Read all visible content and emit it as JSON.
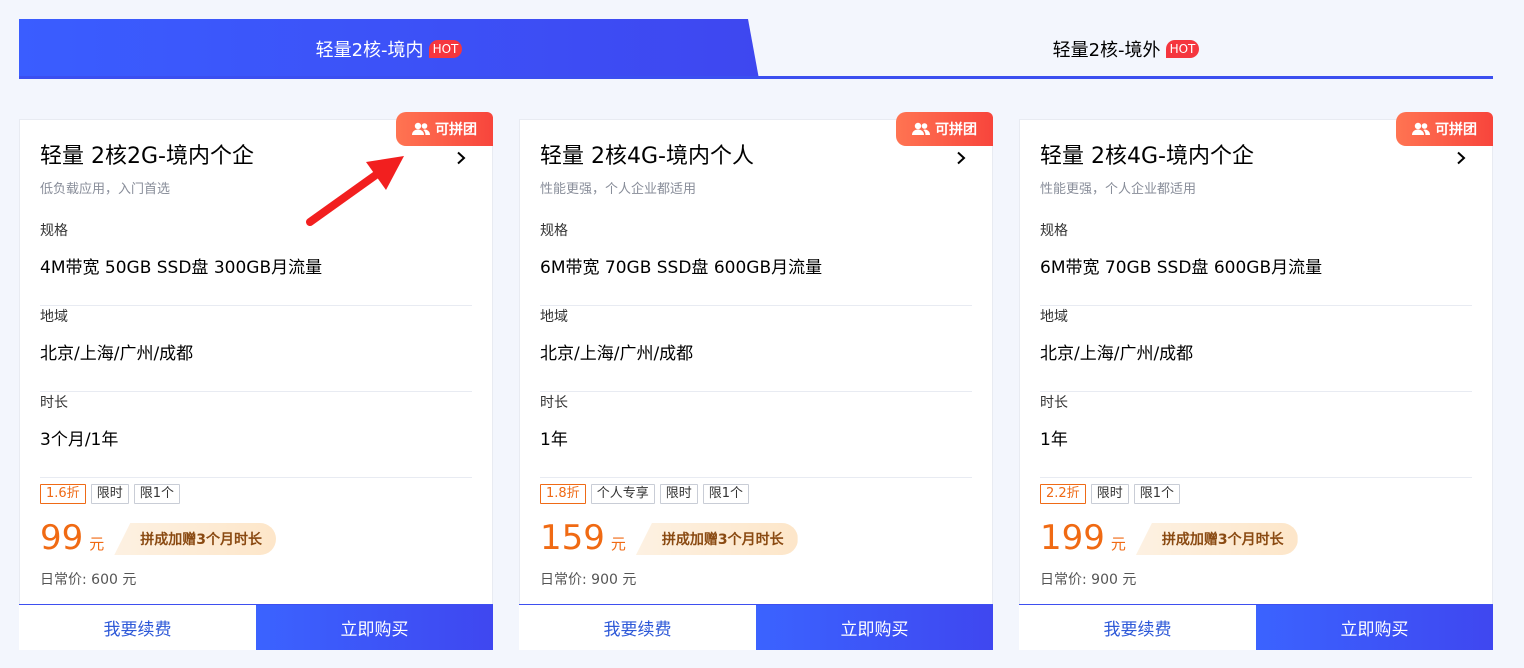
{
  "tabs": [
    {
      "label": "轻量2核-境内",
      "badge": "HOT"
    },
    {
      "label": "轻量2核-境外",
      "badge": "HOT"
    }
  ],
  "cards": [
    {
      "badge": "可拼团",
      "title": "轻量 2核2G-境内个企",
      "subtitle": "低负载应用，入门首选",
      "fields": [
        {
          "label": "规格",
          "value": "4M带宽 50GB SSD盘 300GB月流量"
        },
        {
          "label": "地域",
          "value": "北京/上海/广州/成都"
        },
        {
          "label": "时长",
          "value": "3个月/1年"
        }
      ],
      "tags": [
        "1.6折",
        "限时",
        "限1个"
      ],
      "price": "99",
      "unit": "元",
      "promo": "拼成加赠3个月时长",
      "original_price": "日常价: 600 元",
      "renew_label": "我要续费",
      "buy_label": "立即购买"
    },
    {
      "badge": "可拼团",
      "title": "轻量 2核4G-境内个人",
      "subtitle": "性能更强，个人企业都适用",
      "fields": [
        {
          "label": "规格",
          "value": "6M带宽 70GB SSD盘 600GB月流量"
        },
        {
          "label": "地域",
          "value": "北京/上海/广州/成都"
        },
        {
          "label": "时长",
          "value": "1年"
        }
      ],
      "tags": [
        "1.8折",
        "个人专享",
        "限时",
        "限1个"
      ],
      "price": "159",
      "unit": "元",
      "promo": "拼成加赠3个月时长",
      "original_price": "日常价: 900 元",
      "renew_label": "我要续费",
      "buy_label": "立即购买"
    },
    {
      "badge": "可拼团",
      "title": "轻量 2核4G-境内个企",
      "subtitle": "性能更强，个人企业都适用",
      "fields": [
        {
          "label": "规格",
          "value": "6M带宽 70GB SSD盘 600GB月流量"
        },
        {
          "label": "地域",
          "value": "北京/上海/广州/成都"
        },
        {
          "label": "时长",
          "value": "1年"
        }
      ],
      "tags": [
        "2.2折",
        "限时",
        "限1个"
      ],
      "price": "199",
      "unit": "元",
      "promo": "拼成加赠3个月时长",
      "original_price": "日常价: 900 元",
      "renew_label": "我要续费",
      "buy_label": "立即购买"
    }
  ],
  "colors": {
    "accent_blue": "#3e47f0",
    "price_orange": "#f06a13",
    "badge_red": "#f8453c",
    "annotation_arrow": "#f21f1f"
  },
  "icons": {
    "badge_icon": "users-icon",
    "card_chevron": "chevron-right-icon",
    "annotation": "red-arrow-icon"
  }
}
